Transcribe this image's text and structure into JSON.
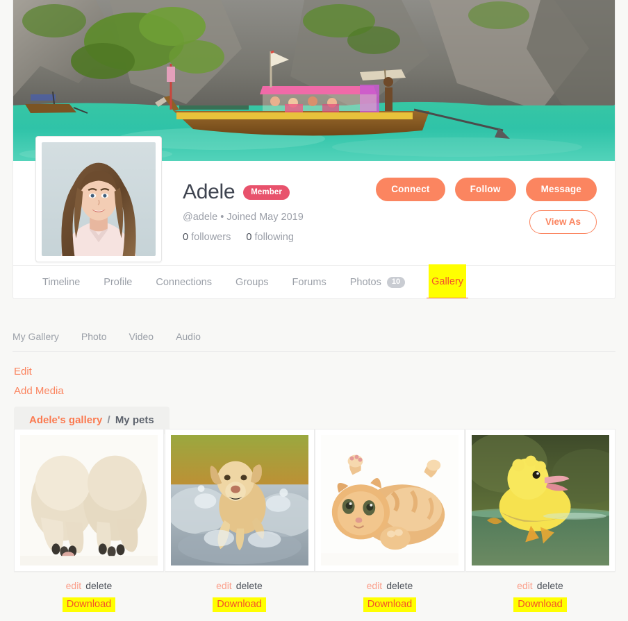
{
  "profile": {
    "name": "Adele",
    "badge": "Member",
    "handle": "@adele • Joined May 2019",
    "followers_count": "0",
    "followers_label": "followers",
    "following_count": "0",
    "following_label": "following",
    "cover_alt": "tropical-cove-longtail-boat",
    "avatar_alt": "woman-portrait"
  },
  "actions": {
    "connect": "Connect",
    "follow": "Follow",
    "message": "Message",
    "view_as": "View As"
  },
  "tabs": [
    {
      "label": "Timeline",
      "count": null,
      "highlighted": false
    },
    {
      "label": "Profile",
      "count": null,
      "highlighted": false
    },
    {
      "label": "Connections",
      "count": null,
      "highlighted": false
    },
    {
      "label": "Groups",
      "count": null,
      "highlighted": false
    },
    {
      "label": "Forums",
      "count": null,
      "highlighted": false
    },
    {
      "label": "Photos",
      "count": "10",
      "highlighted": false
    },
    {
      "label": "Gallery",
      "count": null,
      "highlighted": true
    }
  ],
  "subnav": [
    {
      "label": "My Gallery"
    },
    {
      "label": "Photo"
    },
    {
      "label": "Video"
    },
    {
      "label": "Audio"
    }
  ],
  "gallery_controls": {
    "edit": "Edit",
    "add_media": "Add Media",
    "breadcrumb_root": "Adele's gallery",
    "breadcrumb_separator": "/",
    "breadcrumb_current": "My pets"
  },
  "media_items": [
    {
      "alt": "two-puppy-paws",
      "edit": "edit",
      "delete": "delete",
      "download": "Download"
    },
    {
      "alt": "dog-running-through-water",
      "edit": "edit",
      "delete": "delete",
      "download": "Download"
    },
    {
      "alt": "ginger-kitten-lying-on-back",
      "edit": "edit",
      "delete": "delete",
      "download": "Download"
    },
    {
      "alt": "yellow-duckling-swimming",
      "edit": "edit",
      "delete": "delete",
      "download": "Download"
    }
  ],
  "colors": {
    "accent": "#fb8560",
    "badge": "#e8526c",
    "highlight": "#ffff00",
    "highlight_text": "#f4522a",
    "page_bg": "#f8f8f6"
  }
}
